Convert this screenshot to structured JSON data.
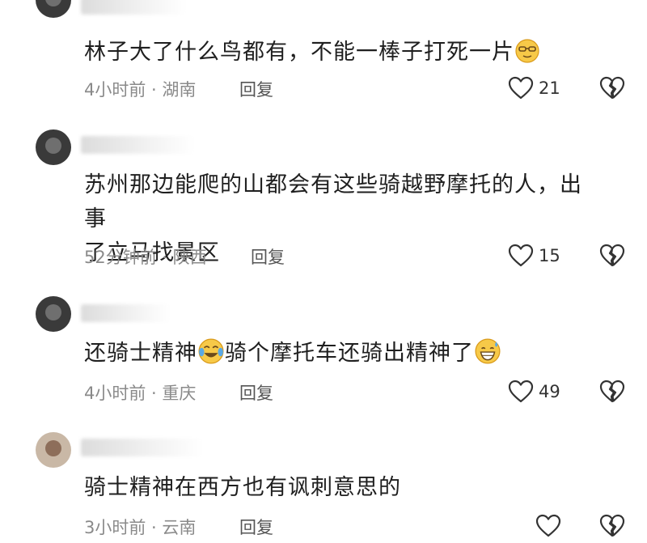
{
  "comments": [
    {
      "text_parts": [
        "林子大了什么鸟都有，不能一棒子打死一片"
      ],
      "emoji_after": [
        "glasses-face"
      ],
      "meta": "4小时前 · 湖南",
      "reply_label": "回复",
      "likes": "21"
    },
    {
      "text_parts": [
        "苏州那边能爬的山都会有这些骑越野摩托的人，出事",
        "了立马找景区"
      ],
      "meta": "52分钟前 · 陕西",
      "reply_label": "回复",
      "likes": "15"
    },
    {
      "text_parts": [
        "还骑士精神",
        "骑个摩托车还骑出精神了"
      ],
      "emoji_after": [
        "tears-of-joy",
        "grinning-sweat"
      ],
      "meta": "4小时前 · 重庆",
      "reply_label": "回复",
      "likes": "49"
    },
    {
      "text_parts": [
        "骑士精神在西方也有讽刺意思的"
      ],
      "meta": "3小时前 · 云南",
      "reply_label": "回复",
      "likes": ""
    }
  ],
  "icons": {
    "like": "heart-outline-icon",
    "dislike": "broken-heart-icon"
  },
  "colors": {
    "text": "#1f1f1f",
    "meta": "#8a8a8a",
    "emoji": "#f7c948"
  }
}
